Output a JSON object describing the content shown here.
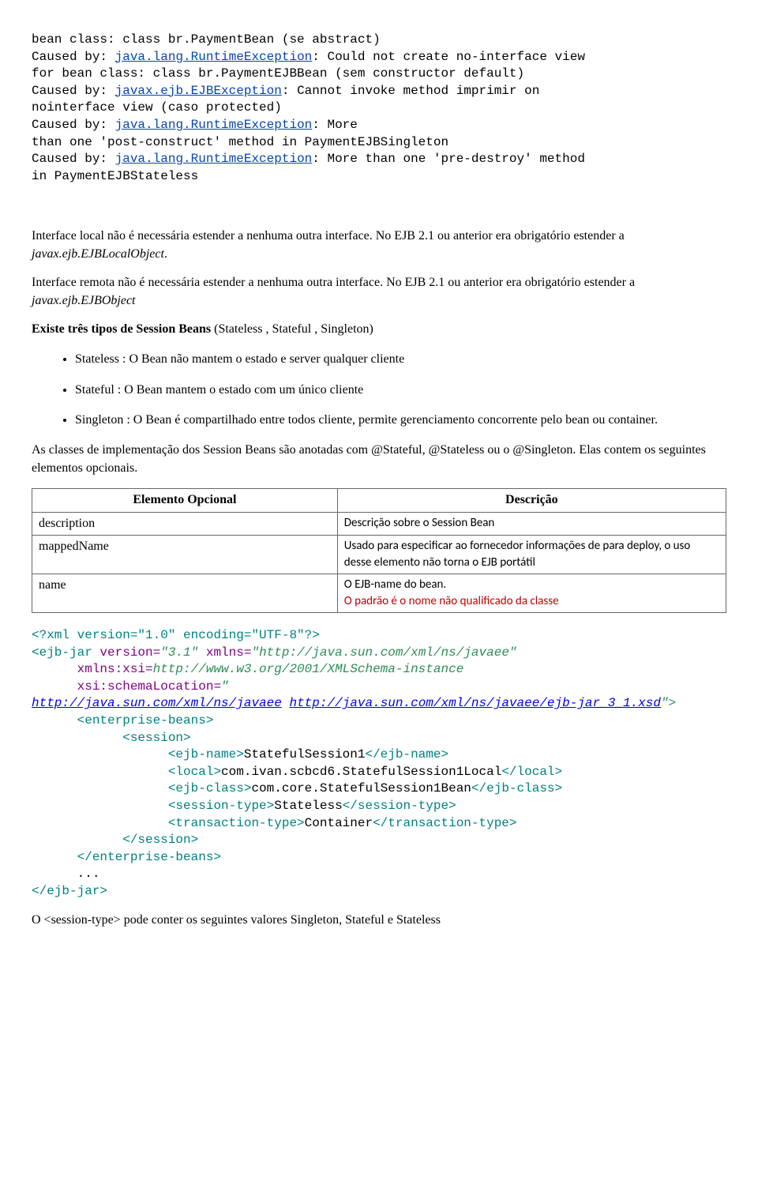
{
  "stack": {
    "l1a": "bean class: class br.PaymentBean (se abstract)",
    "l2a": "Caused by: ",
    "l2b": "java.lang.RuntimeException",
    "l2c": ": Could not create no-interface view",
    "l3a": "for bean class: class br.PaymentEJBBean (sem constructor default)",
    "l4a": "Caused by: ",
    "l4b": "javax.ejb.EJBException",
    "l4c": ": Cannot invoke method imprimir on",
    "l5a": "nointerface view (caso protected)",
    "l6a": "Caused by: ",
    "l6b": "java.lang.RuntimeException",
    "l6c": ": More",
    "l7a": "than one 'post-construct' method in PaymentEJBSingleton",
    "l8a": "Caused by: ",
    "l8b": "java.lang.RuntimeException",
    "l8c": ": More than one 'pre-destroy' method",
    "l9a": "in PaymentEJBStateless"
  },
  "p1a": "Interface local não é necessária estender a nenhuma outra interface. No EJB 2.1 ou anterior era obrigatório estender a ",
  "p1b": " javax.ejb.EJBLocalObject",
  "p1c": ".",
  "p2a": "Interface remota não é necessária estender a nenhuma outra interface. No EJB 2.1 ou anterior era obrigatório estender a ",
  "p2b": " javax.ejb.EJBObject",
  "p3a": "Existe três tipos de Session Beans ",
  "p3b": "(Stateless , Stateful , Singleton)",
  "bullets": {
    "b1": "Stateless : O Bean não mantem o estado e server qualquer cliente",
    "b2": "Stateful : O Bean mantem o estado com um único cliente",
    "b3": "Singleton : O Bean é compartilhado entre todos cliente, permite gerenciamento concorrente pelo bean ou container."
  },
  "p4": "As classes de implementação dos Session Beans são anotadas com @Stateful, @Stateless ou o @Singleton. Elas contem os seguintes elementos opcionais.",
  "table": {
    "h1": "Elemento Opcional",
    "h2": "Descrição",
    "r1c1": "description",
    "r1c2": "Descrição sobre o Session Bean",
    "r2c1": "mappedName",
    "r2c2": "Usado para especificar ao fornecedor informações de para deploy, o uso desse elemento não torna o EJB portátil",
    "r3c1": "name",
    "r3c2a": "O EJB-name do bean.",
    "r3c2b": "O padrão é o nome não qualificado da classe"
  },
  "xml": {
    "decl": "<?xml version=\"1.0\" encoding=\"UTF-8\"?>",
    "root_open": "<ejb-jar",
    "root_attr1": " version=",
    "root_val1": "\"3.1\"",
    "root_attr2": " xmlns=",
    "root_val2": "\"http://java.sun.com/xml/ns/javaee\"",
    "ns2a": "xmlns:xsi=",
    "ns2b": "http://www.w3.org/2001/XMLSchema-instance",
    "sl1": "xsi:schemaLocation=",
    "sl2": "\"",
    "sl3": "http://java.sun.com/xml/ns/javaee",
    "sl4": " ",
    "sl5": "http://java.sun.com/xml/ns/javaee/ejb-jar_3_1.xsd",
    "sl6": "\">",
    "eb_open": "<enterprise-beans>",
    "sess_open": "<session>",
    "ejbname_o": "<ejb-name>",
    "ejbname_t": "StatefulSession1",
    "ejbname_c": "</ejb-name>",
    "local_o": "<local>",
    "local_t": "com.ivan.scbcd6.StatefulSession1Local",
    "local_c": "</local>",
    "class_o": "<ejb-class>",
    "class_t": "com.core.StatefulSession1Bean",
    "class_c": "</ejb-class>",
    "stype_o": "<session-type>",
    "stype_t": "Stateless",
    "stype_c": "</session-type>",
    "ttype_o": "<transaction-type>",
    "ttype_t": "Container",
    "ttype_c": "</transaction-type>",
    "sess_close": "</session>",
    "eb_close": "</enterprise-beans>",
    "dots": "...",
    "root_close": "</ejb-jar>"
  },
  "p5": "O <session-type> pode conter os seguintes valores Singleton,  Stateful e  Stateless"
}
